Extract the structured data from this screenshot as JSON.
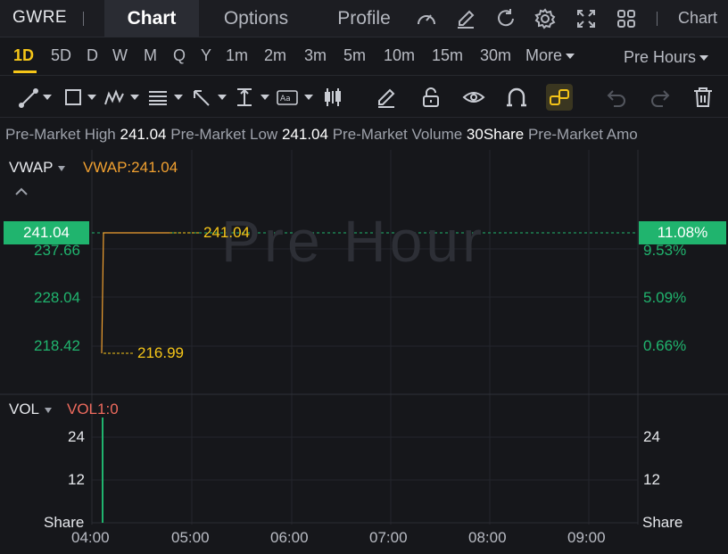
{
  "header": {
    "ticker": "GWRE",
    "tabs": [
      {
        "label": "Chart",
        "active": true
      },
      {
        "label": "Options",
        "active": false
      },
      {
        "label": "Profile",
        "active": false
      }
    ],
    "right_link": "Chart",
    "icons": [
      "gauge-icon",
      "edit-icon",
      "refresh-icon",
      "settings-icon",
      "expand-icon",
      "grid-icon"
    ]
  },
  "periods": {
    "items": [
      "1D",
      "5D",
      "D",
      "W",
      "M",
      "Q",
      "Y",
      "1m",
      "2m",
      "3m",
      "5m",
      "10m",
      "15m",
      "30m"
    ],
    "active": "1D",
    "more_label": "More",
    "session_label": "Pre Hours"
  },
  "toolbar": {
    "tools": [
      "line-tool-icon",
      "rectangle-tool-icon",
      "pattern-tool-icon",
      "fib-tool-icon",
      "arrow-tool-icon",
      "measure-tool-icon",
      "text-tool-icon",
      "candle-tool-icon",
      "pencil-icon",
      "unlock-icon",
      "eye-icon",
      "magnet-icon",
      "link-icon",
      "undo-icon",
      "redo-icon",
      "trash-icon"
    ]
  },
  "info": {
    "high_label": "Pre-Market High",
    "high_value": "241.04",
    "low_label": "Pre-Market Low",
    "low_value": "241.04",
    "volume_label": "Pre-Market Volume",
    "volume_value": "30Share",
    "amount_label": "Pre-Market Amo"
  },
  "price_panel": {
    "indicator": "VWAP",
    "indicator_value": "VWAP:241.04",
    "current_price": "241.04",
    "current_pct": "11.08%",
    "left_axis": [
      "237.66",
      "228.04",
      "218.42"
    ],
    "right_axis": [
      "9.53%",
      "5.09%",
      "0.66%"
    ],
    "last_label": "241.04",
    "low_label": "216.99",
    "watermark": "Pre Hour"
  },
  "volume_panel": {
    "indicator": "VOL",
    "indicator_value": "VOL1:0",
    "left_axis": [
      "24",
      "12",
      "Share"
    ],
    "right_axis": [
      "24",
      "12",
      "Share"
    ]
  },
  "time_axis": [
    "04:00",
    "05:00",
    "06:00",
    "07:00",
    "08:00",
    "09:00"
  ],
  "colors": {
    "accent": "#f5c518",
    "up": "#20b46e",
    "vwap": "#f0a030",
    "vol_value": "#ef6b5e"
  }
}
